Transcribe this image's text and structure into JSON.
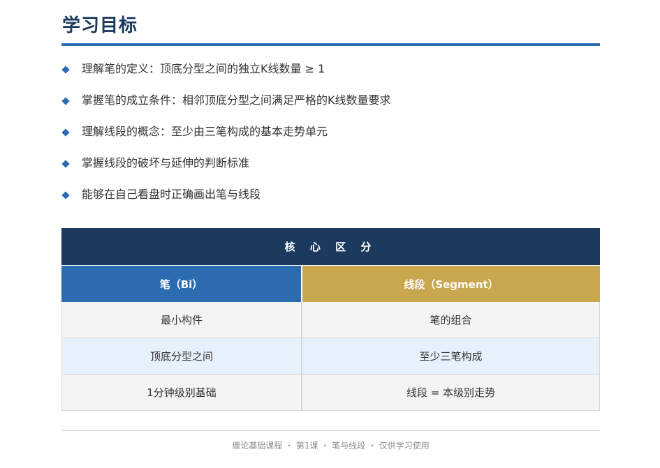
{
  "title": "学习目标",
  "objectives": [
    "理解笔的定义：顶底分型之间的独立K线数量 ≥ 1",
    "掌握笔的成立条件：相邻顶底分型之间满足严格的K线数量要求",
    "理解线段的概念：至少由三笔构成的基本走势单元",
    "掌握线段的破坏与延伸的判断标准",
    "能够在自己看盘时正确画出笔与线段"
  ],
  "table": {
    "header": "核 心 区 分",
    "col1": "笔（Bi）",
    "col2": "线段（Segment）",
    "rows": [
      [
        "最小构件",
        "笔的组合"
      ],
      [
        "顶底分型之间",
        "至少三笔构成"
      ],
      [
        "1分钟级别基础",
        "线段 = 本级别走势"
      ]
    ]
  },
  "footer": "缠论基础课程 ・ 第1课 ・ 笔与线段 ・ 仅供学习使用",
  "colors": {
    "title": "#1b3a5e",
    "accent_blue": "#2b6cb0",
    "header_navy": "#1c3a5e",
    "gold": "#c8a74e",
    "row_blue": "#e6f1fb",
    "row_gray": "#f4f4f4"
  },
  "icons": {
    "bullet": "diamond-bullet-icon"
  }
}
